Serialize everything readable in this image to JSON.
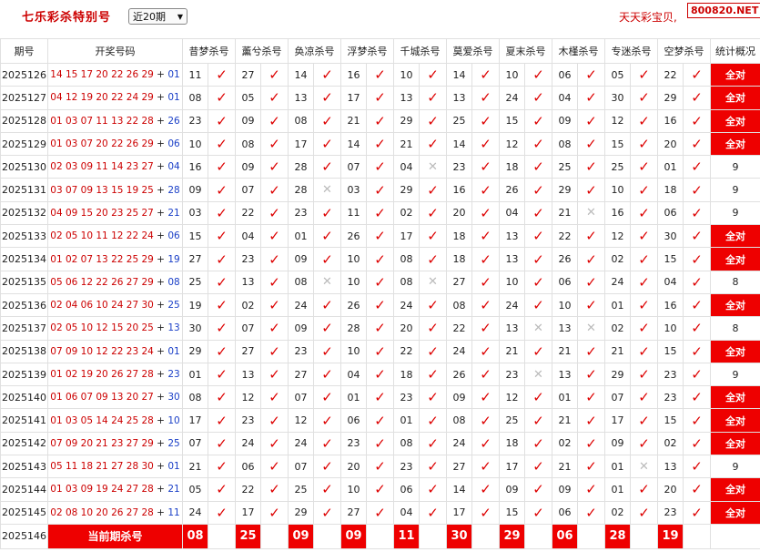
{
  "header": {
    "title": "七乐彩杀特别号",
    "period_select": "近20期",
    "slogan": "天天彩宝贝,",
    "brand": "800820.NET"
  },
  "table": {
    "columns": [
      "期号",
      "开奖号码",
      "昔梦杀号",
      "薰兮杀号",
      "奂凉杀号",
      "浮梦杀号",
      "千城杀号",
      "莫爱杀号",
      "夏末杀号",
      "木槿杀号",
      "专迷杀号",
      "空梦杀号",
      "统计概况"
    ],
    "rows": [
      {
        "issue": "2025126",
        "nums": "14 15 17 20 22 26 29",
        "special": "01",
        "kills": [
          [
            "11",
            1
          ],
          [
            "27",
            1
          ],
          [
            "14",
            1
          ],
          [
            "16",
            1
          ],
          [
            "10",
            1
          ],
          [
            "14",
            1
          ],
          [
            "10",
            1
          ],
          [
            "06",
            1
          ],
          [
            "05",
            1
          ],
          [
            "22",
            1
          ]
        ],
        "stat": "全对"
      },
      {
        "issue": "2025127",
        "nums": "04 12 19 20 22 24 29",
        "special": "01",
        "kills": [
          [
            "08",
            1
          ],
          [
            "05",
            1
          ],
          [
            "13",
            1
          ],
          [
            "17",
            1
          ],
          [
            "13",
            1
          ],
          [
            "13",
            1
          ],
          [
            "24",
            1
          ],
          [
            "04",
            1
          ],
          [
            "30",
            1
          ],
          [
            "29",
            1
          ]
        ],
        "stat": "全对"
      },
      {
        "issue": "2025128",
        "nums": "01 03 07 11 13 22 28",
        "special": "26",
        "kills": [
          [
            "23",
            1
          ],
          [
            "09",
            1
          ],
          [
            "08",
            1
          ],
          [
            "21",
            1
          ],
          [
            "29",
            1
          ],
          [
            "25",
            1
          ],
          [
            "15",
            1
          ],
          [
            "09",
            1
          ],
          [
            "12",
            1
          ],
          [
            "16",
            1
          ]
        ],
        "stat": "全对"
      },
      {
        "issue": "2025129",
        "nums": "01 03 07 20 22 26 29",
        "special": "06",
        "kills": [
          [
            "10",
            1
          ],
          [
            "08",
            1
          ],
          [
            "17",
            1
          ],
          [
            "14",
            1
          ],
          [
            "21",
            1
          ],
          [
            "14",
            1
          ],
          [
            "12",
            1
          ],
          [
            "08",
            1
          ],
          [
            "15",
            1
          ],
          [
            "20",
            1
          ]
        ],
        "stat": "全对"
      },
      {
        "issue": "2025130",
        "nums": "02 03 09 11 14 23 27",
        "special": "04",
        "kills": [
          [
            "16",
            1
          ],
          [
            "09",
            1
          ],
          [
            "28",
            1
          ],
          [
            "07",
            1
          ],
          [
            "04",
            0
          ],
          [
            "23",
            1
          ],
          [
            "18",
            1
          ],
          [
            "25",
            1
          ],
          [
            "25",
            1
          ],
          [
            "01",
            1
          ]
        ],
        "stat": "9"
      },
      {
        "issue": "2025131",
        "nums": "03 07 09 13 15 19 25",
        "special": "28",
        "kills": [
          [
            "09",
            1
          ],
          [
            "07",
            1
          ],
          [
            "28",
            0
          ],
          [
            "03",
            1
          ],
          [
            "29",
            1
          ],
          [
            "16",
            1
          ],
          [
            "26",
            1
          ],
          [
            "29",
            1
          ],
          [
            "10",
            1
          ],
          [
            "18",
            1
          ]
        ],
        "stat": "9"
      },
      {
        "issue": "2025132",
        "nums": "04 09 15 20 23 25 27",
        "special": "21",
        "kills": [
          [
            "03",
            1
          ],
          [
            "22",
            1
          ],
          [
            "23",
            1
          ],
          [
            "11",
            1
          ],
          [
            "02",
            1
          ],
          [
            "20",
            1
          ],
          [
            "04",
            1
          ],
          [
            "21",
            0
          ],
          [
            "16",
            1
          ],
          [
            "06",
            1
          ]
        ],
        "stat": "9"
      },
      {
        "issue": "2025133",
        "nums": "02 05 10 11 12 22 24",
        "special": "06",
        "kills": [
          [
            "15",
            1
          ],
          [
            "04",
            1
          ],
          [
            "01",
            1
          ],
          [
            "26",
            1
          ],
          [
            "17",
            1
          ],
          [
            "18",
            1
          ],
          [
            "13",
            1
          ],
          [
            "22",
            1
          ],
          [
            "12",
            1
          ],
          [
            "30",
            1
          ]
        ],
        "stat": "全对"
      },
      {
        "issue": "2025134",
        "nums": "01 02 07 13 22 25 29",
        "special": "19",
        "kills": [
          [
            "27",
            1
          ],
          [
            "23",
            1
          ],
          [
            "09",
            1
          ],
          [
            "10",
            1
          ],
          [
            "08",
            1
          ],
          [
            "18",
            1
          ],
          [
            "13",
            1
          ],
          [
            "26",
            1
          ],
          [
            "02",
            1
          ],
          [
            "15",
            1
          ]
        ],
        "stat": "全对"
      },
      {
        "issue": "2025135",
        "nums": "05 06 12 22 26 27 29",
        "special": "08",
        "kills": [
          [
            "25",
            1
          ],
          [
            "13",
            1
          ],
          [
            "08",
            0
          ],
          [
            "10",
            1
          ],
          [
            "08",
            0
          ],
          [
            "27",
            1
          ],
          [
            "10",
            1
          ],
          [
            "06",
            1
          ],
          [
            "24",
            1
          ],
          [
            "04",
            1
          ]
        ],
        "stat": "8"
      },
      {
        "issue": "2025136",
        "nums": "02 04 06 10 24 27 30",
        "special": "25",
        "kills": [
          [
            "19",
            1
          ],
          [
            "02",
            1
          ],
          [
            "24",
            1
          ],
          [
            "26",
            1
          ],
          [
            "24",
            1
          ],
          [
            "08",
            1
          ],
          [
            "24",
            1
          ],
          [
            "10",
            1
          ],
          [
            "01",
            1
          ],
          [
            "16",
            1
          ]
        ],
        "stat": "全对"
      },
      {
        "issue": "2025137",
        "nums": "02 05 10 12 15 20 25",
        "special": "13",
        "kills": [
          [
            "30",
            1
          ],
          [
            "07",
            1
          ],
          [
            "09",
            1
          ],
          [
            "28",
            1
          ],
          [
            "20",
            1
          ],
          [
            "22",
            1
          ],
          [
            "13",
            0
          ],
          [
            "13",
            0
          ],
          [
            "02",
            1
          ],
          [
            "10",
            1
          ]
        ],
        "stat": "8"
      },
      {
        "issue": "2025138",
        "nums": "07 09 10 12 22 23 24",
        "special": "01",
        "kills": [
          [
            "29",
            1
          ],
          [
            "27",
            1
          ],
          [
            "23",
            1
          ],
          [
            "10",
            1
          ],
          [
            "22",
            1
          ],
          [
            "24",
            1
          ],
          [
            "21",
            1
          ],
          [
            "21",
            1
          ],
          [
            "21",
            1
          ],
          [
            "15",
            1
          ]
        ],
        "stat": "全对"
      },
      {
        "issue": "2025139",
        "nums": "01 02 19 20 26 27 28",
        "special": "23",
        "kills": [
          [
            "01",
            1
          ],
          [
            "13",
            1
          ],
          [
            "27",
            1
          ],
          [
            "04",
            1
          ],
          [
            "18",
            1
          ],
          [
            "26",
            1
          ],
          [
            "23",
            0
          ],
          [
            "13",
            1
          ],
          [
            "29",
            1
          ],
          [
            "23",
            1
          ]
        ],
        "stat": "9"
      },
      {
        "issue": "2025140",
        "nums": "01 06 07 09 13 20 27",
        "special": "30",
        "kills": [
          [
            "08",
            1
          ],
          [
            "12",
            1
          ],
          [
            "07",
            1
          ],
          [
            "01",
            1
          ],
          [
            "23",
            1
          ],
          [
            "09",
            1
          ],
          [
            "12",
            1
          ],
          [
            "01",
            1
          ],
          [
            "07",
            1
          ],
          [
            "23",
            1
          ]
        ],
        "stat": "全对"
      },
      {
        "issue": "2025141",
        "nums": "01 03 05 14 24 25 28",
        "special": "10",
        "kills": [
          [
            "17",
            1
          ],
          [
            "23",
            1
          ],
          [
            "12",
            1
          ],
          [
            "06",
            1
          ],
          [
            "01",
            1
          ],
          [
            "08",
            1
          ],
          [
            "25",
            1
          ],
          [
            "21",
            1
          ],
          [
            "17",
            1
          ],
          [
            "15",
            1
          ]
        ],
        "stat": "全对"
      },
      {
        "issue": "2025142",
        "nums": "07 09 20 21 23 27 29",
        "special": "25",
        "kills": [
          [
            "07",
            1
          ],
          [
            "24",
            1
          ],
          [
            "24",
            1
          ],
          [
            "23",
            1
          ],
          [
            "08",
            1
          ],
          [
            "24",
            1
          ],
          [
            "18",
            1
          ],
          [
            "02",
            1
          ],
          [
            "09",
            1
          ],
          [
            "02",
            1
          ]
        ],
        "stat": "全对"
      },
      {
        "issue": "2025143",
        "nums": "05 11 18 21 27 28 30",
        "special": "01",
        "kills": [
          [
            "21",
            1
          ],
          [
            "06",
            1
          ],
          [
            "07",
            1
          ],
          [
            "20",
            1
          ],
          [
            "23",
            1
          ],
          [
            "27",
            1
          ],
          [
            "17",
            1
          ],
          [
            "21",
            1
          ],
          [
            "01",
            0
          ],
          [
            "13",
            1
          ]
        ],
        "stat": "9"
      },
      {
        "issue": "2025144",
        "nums": "01 03 09 19 24 27 28",
        "special": "21",
        "kills": [
          [
            "05",
            1
          ],
          [
            "22",
            1
          ],
          [
            "25",
            1
          ],
          [
            "10",
            1
          ],
          [
            "06",
            1
          ],
          [
            "14",
            1
          ],
          [
            "09",
            1
          ],
          [
            "09",
            1
          ],
          [
            "01",
            1
          ],
          [
            "20",
            1
          ]
        ],
        "stat": "全对"
      },
      {
        "issue": "2025145",
        "nums": "02 08 10 20 26 27 28",
        "special": "11",
        "kills": [
          [
            "24",
            1
          ],
          [
            "17",
            1
          ],
          [
            "29",
            1
          ],
          [
            "27",
            1
          ],
          [
            "04",
            1
          ],
          [
            "17",
            1
          ],
          [
            "15",
            1
          ],
          [
            "06",
            1
          ],
          [
            "02",
            1
          ],
          [
            "23",
            1
          ]
        ],
        "stat": "全对"
      }
    ],
    "current": {
      "issue": "2025146",
      "label": "当前期杀号",
      "kills": [
        "08",
        "25",
        "09",
        "09",
        "11",
        "30",
        "29",
        "06",
        "28",
        "19"
      ]
    }
  },
  "marks": {
    "hit": "✓",
    "miss": "✕",
    "all_correct_color": "#e00"
  }
}
